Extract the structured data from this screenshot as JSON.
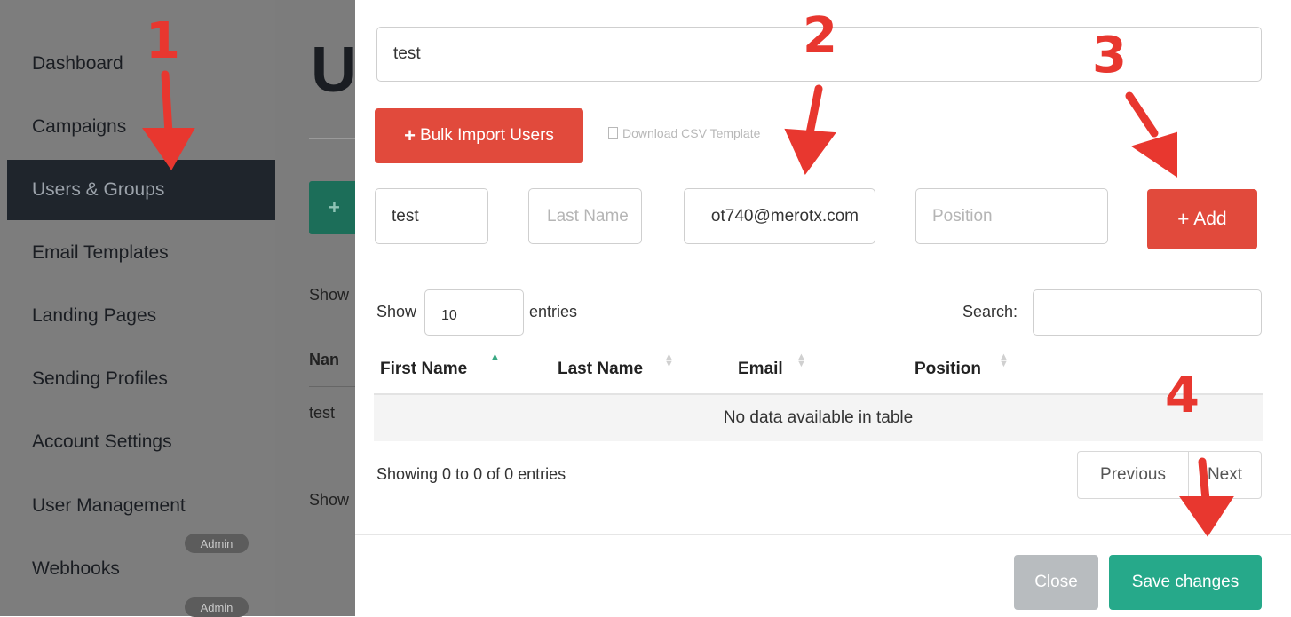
{
  "sidebar": {
    "items": [
      {
        "label": "Dashboard"
      },
      {
        "label": "Campaigns"
      },
      {
        "label": "Users & Groups"
      },
      {
        "label": "Email Templates"
      },
      {
        "label": "Landing Pages"
      },
      {
        "label": "Sending Profiles"
      },
      {
        "label": "Account Settings"
      },
      {
        "label": "User Management"
      },
      {
        "label": "Webhooks"
      }
    ],
    "badges": [
      "Admin",
      "Admin"
    ]
  },
  "background": {
    "title_fragment": "U",
    "button_fragment": "+",
    "show_1": "Show",
    "col_fragment": "Nan",
    "row_fragment": "test",
    "show_2": "Show"
  },
  "modal": {
    "group_name": "test",
    "bulk_import_label": "Bulk Import Users",
    "download_csv_label": "Download CSV Template",
    "new_user": {
      "first_name": "test",
      "last_name_placeholder": "Last Name",
      "email": "ot740@merotx.com",
      "position_placeholder": "Position"
    },
    "add_label": "Add",
    "table": {
      "show_label": "Show",
      "page_size": "10",
      "entries_label": "entries",
      "search_label": "Search:",
      "columns": [
        "First Name",
        "Last Name",
        "Email",
        "Position"
      ],
      "empty_text": "No data available in table",
      "info": "Showing 0 to 0 of 0 entries",
      "previous_label": "Previous",
      "next_label": "Next"
    },
    "close_label": "Close",
    "save_label": "Save changes"
  },
  "annotations": [
    "1",
    "2",
    "3",
    "4"
  ],
  "colors": {
    "accent_red": "#e14a3c",
    "save_green": "#26a98a",
    "annotation_red": "#e8372f"
  }
}
